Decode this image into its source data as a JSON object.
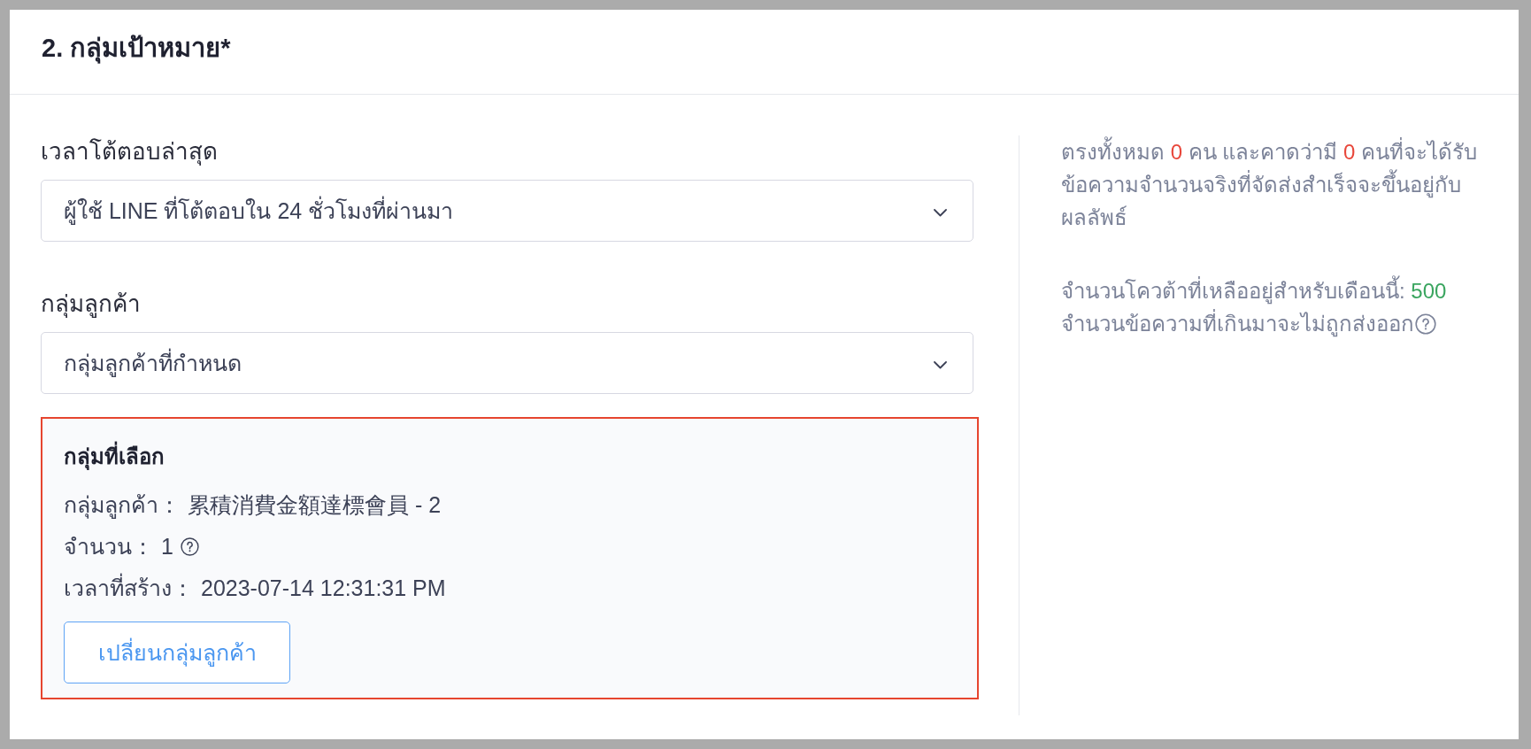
{
  "section": {
    "title": "2. กลุ่มเป้าหมาย*"
  },
  "fields": [
    {
      "label": "เวลาโต้ตอบล่าสุด",
      "value": "ผู้ใช้ LINE ที่โต้ตอบใน 24 ชั่วโมงที่ผ่านมา"
    },
    {
      "label": "กลุ่มลูกค้า",
      "value": "กลุ่มลูกค้าที่กำหนด"
    }
  ],
  "selected_group": {
    "title": "กลุ่มที่เลือก",
    "highlighted": true,
    "rows": [
      {
        "label": "กลุ่มลูกค้า：",
        "value": "累積消費金額達標會員 - 2",
        "help": false
      },
      {
        "label": "จำนวน：",
        "value": "1",
        "help": true
      },
      {
        "label": "เวลาที่สร้าง：",
        "value": "2023-07-14 12:31:31 PM",
        "help": false
      }
    ],
    "button": "เปลี่ยนกลุ่มลูกค้า"
  },
  "summary": {
    "estimate": [
      {
        "text": "ตรงทั้งหมด ",
        "kind": "text"
      },
      {
        "text": "0",
        "kind": "count"
      },
      {
        "text": " คน และคาดว่ามี ",
        "kind": "text"
      },
      {
        "text": "0",
        "kind": "count"
      },
      {
        "text": " คนที่จะได้รับข้อความจำนวนจริงที่จัดส่งสำเร็จจะขึ้นอยู่กับผลลัพธ์",
        "kind": "text"
      }
    ],
    "quota": [
      {
        "text": "จำนวนโควต้าที่เหลืออยู่สำหรับเดือนนี้: ",
        "kind": "text"
      },
      {
        "text": "500",
        "kind": "quota"
      }
    ],
    "note": {
      "text": "จำนวนข้อความที่เกินมาจะไม่ถูกส่งออก",
      "help": true
    }
  }
}
